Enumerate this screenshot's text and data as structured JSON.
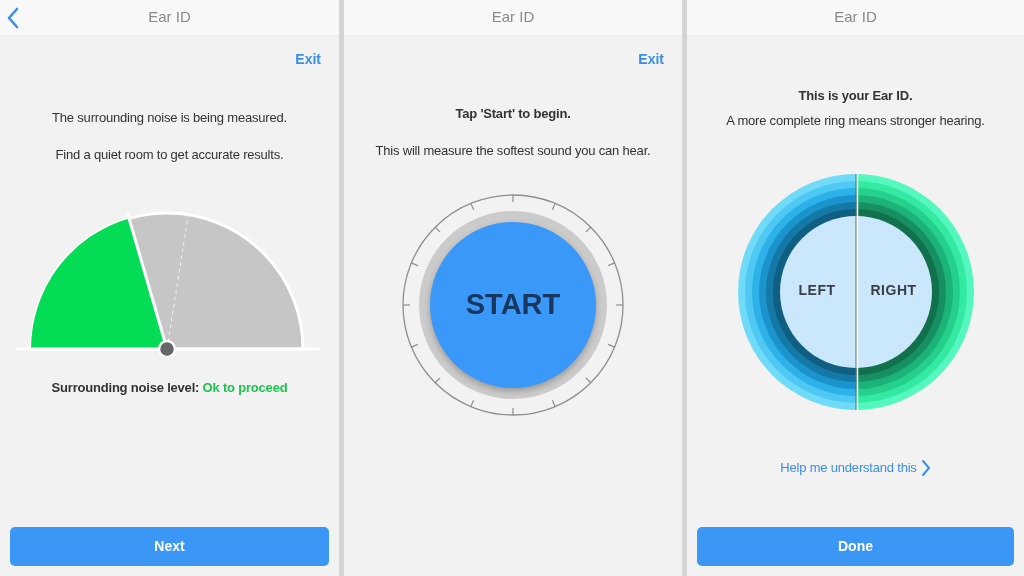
{
  "screens": [
    {
      "kind": "noise",
      "title": "Ear ID",
      "back": true,
      "exit": "Exit",
      "lines": [
        "The surrounding noise is being measured.",
        "Find a quiet room to get accurate results."
      ],
      "status_label": "Surrounding noise level:",
      "status_value": "Ok to proceed",
      "button": "Next"
    },
    {
      "kind": "start",
      "title": "Ear ID",
      "back": false,
      "exit": "Exit",
      "heading": "Tap 'Start' to begin.",
      "lines": [
        "This will measure the softest sound you can hear."
      ],
      "start": "START"
    },
    {
      "kind": "result",
      "title": "Ear ID",
      "back": false,
      "heading": "This is your Ear ID.",
      "lines": [
        "A more complete ring means stronger hearing."
      ],
      "left": "LEFT",
      "right": "RIGHT",
      "help": "Help me understand this",
      "button": "Done"
    }
  ]
}
